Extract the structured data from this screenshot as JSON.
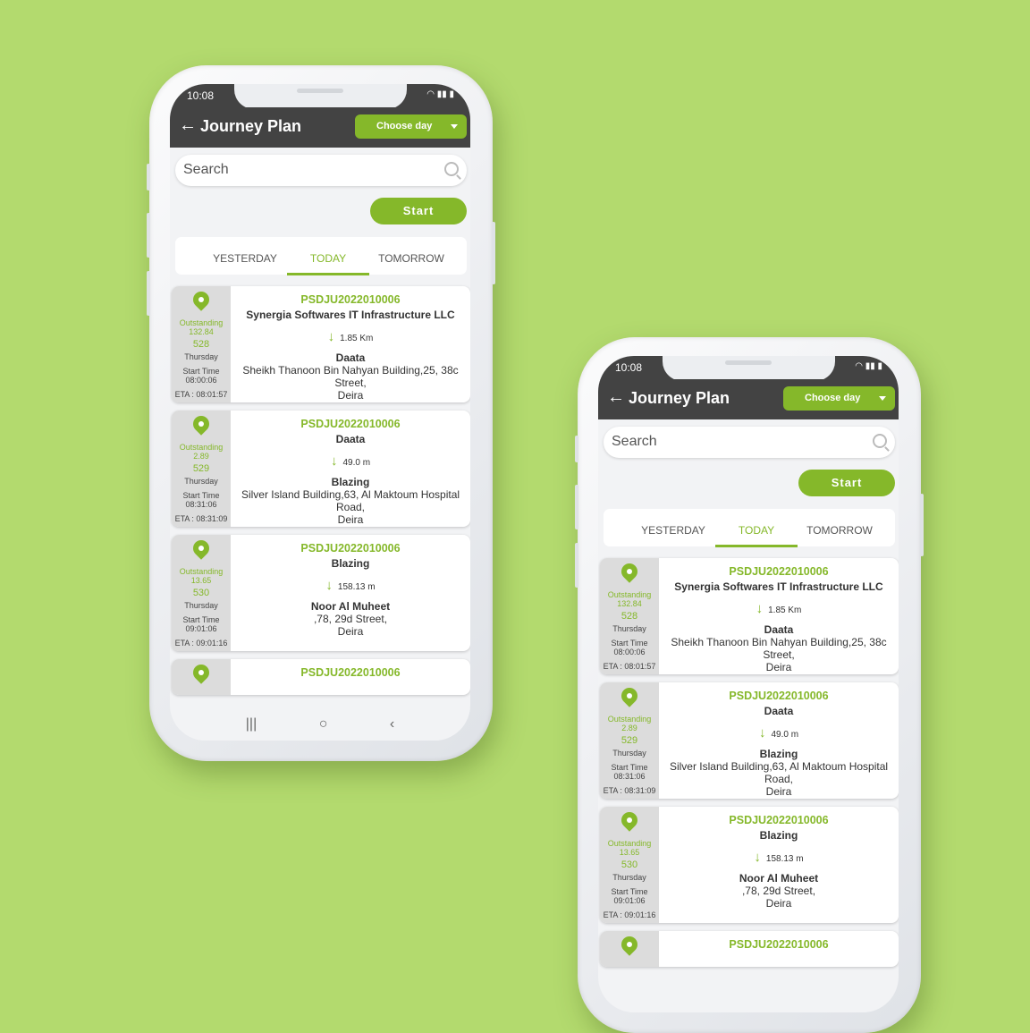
{
  "accent": "#85b82a",
  "status": {
    "time": "10:08",
    "icons": "wifi-signal-battery"
  },
  "header": {
    "title": "Journey Plan",
    "choose_day": "Choose day"
  },
  "search": {
    "placeholder": "Search"
  },
  "start_label": "Start",
  "tabs": [
    {
      "label": "YESTERDAY"
    },
    {
      "label": "TODAY",
      "active": true
    },
    {
      "label": "TOMORROW"
    }
  ],
  "cards": [
    {
      "outstanding_label": "Outstanding",
      "outstanding": "132.84",
      "number": "528",
      "day": "Thursday",
      "start_label": "Start Time",
      "start_time": "08:00:06",
      "eta": "ETA : 08:01:57",
      "code": "PSDJU2022010006",
      "name": "Synergia Softwares IT Infrastructure LLC",
      "distance": "1.85 Km",
      "customer": "Daata",
      "address": [
        "Sheikh Thanoon Bin Nahyan Building,25,  38c",
        "Street,",
        "Deira"
      ]
    },
    {
      "outstanding_label": "Outstanding",
      "outstanding": "2.89",
      "number": "529",
      "day": "Thursday",
      "start_label": "Start Time",
      "start_time": "08:31:06",
      "eta": "ETA : 08:31:09",
      "code": "PSDJU2022010006",
      "name": "Daata",
      "distance": "49.0 m",
      "customer": "Blazing",
      "address": [
        "Silver Island Building,63,  Al Maktoum Hospital",
        "Road,",
        "Deira"
      ]
    },
    {
      "outstanding_label": "Outstanding",
      "outstanding": "13.65",
      "number": "530",
      "day": "Thursday",
      "start_label": "Start Time",
      "start_time": "09:01:06",
      "eta": "ETA : 09:01:16",
      "code": "PSDJU2022010006",
      "name": "Blazing",
      "distance": "158.13 m",
      "customer": "Noor Al Muheet",
      "address": [
        ",78,  29d Street,",
        "Deira"
      ]
    },
    {
      "outstanding_label": "",
      "outstanding": "",
      "number": "",
      "day": "",
      "start_label": "",
      "start_time": "",
      "eta": "",
      "code": "PSDJU2022010006",
      "name": "",
      "distance": "",
      "customer": "",
      "address": []
    }
  ],
  "navbar": {
    "recents": "|||",
    "home": "○",
    "back": "‹"
  }
}
